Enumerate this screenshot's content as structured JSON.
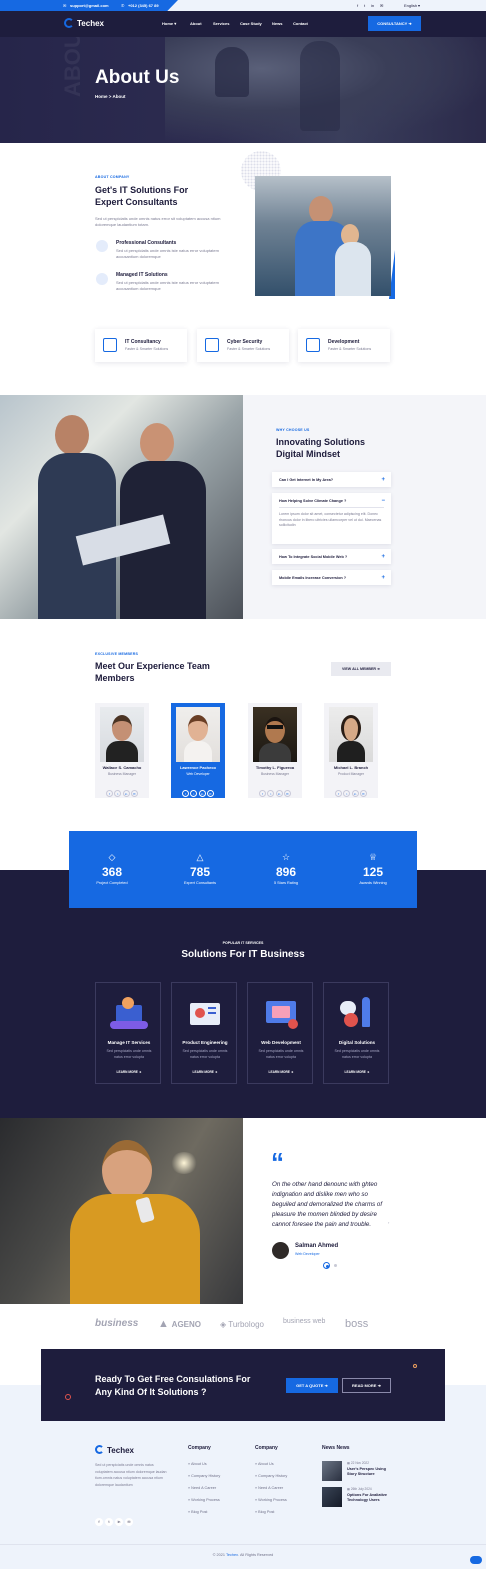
{
  "topbar": {
    "email": "support@gmail.com",
    "phone": "+012 (345) 67 89",
    "language": "English"
  },
  "nav": {
    "brand": "Techex",
    "items": [
      "Home",
      "About",
      "Services",
      "Case Study",
      "News",
      "Contact"
    ],
    "cta": "CONSULTANCY"
  },
  "hero": {
    "title": "About Us",
    "breadcrumb_home": "Home",
    "breadcrumb_sep": ">",
    "breadcrumb_current": "About",
    "watermark": "ABOUT"
  },
  "about": {
    "tag": "ABOUT COMPANY",
    "title_line1": "Get's IT Solutions For",
    "title_line2": "Expert Consultants",
    "text": "Sed ut perspiciatis unde omnis natus error sit voluptatem accusa ntium doloremque laudantium totam.",
    "features": [
      {
        "title": "Professional Consultants",
        "text": "Sed ut perspiciatis unde omnis iste natus error voluptatem accusantium doloremque"
      },
      {
        "title": "Managed IT Solutions",
        "text": "Sed ut perspiciatis unde omnis iste natus error voluptatem accusantium doloremque"
      }
    ]
  },
  "mini_services": [
    {
      "title": "IT Consultancy",
      "sub": "Faster & Smarter Solutions"
    },
    {
      "title": "Cyber Security",
      "sub": "Faster & Smarter Solutions"
    },
    {
      "title": "Development",
      "sub": "Faster & Smarter Solutions"
    }
  ],
  "why": {
    "tag": "WHY CHOOSE US",
    "title_line1": "Innovating Solutions",
    "title_line2": "Digital Mindset",
    "faqs": [
      {
        "q": "Can I Get Internet In My Area?",
        "icon": "+"
      },
      {
        "q": "How Helping Solve Climate Change ?",
        "icon": "−",
        "a": "Lorem ipsum dolor sit amet, consectetur adipiscing elit. Donec rhoncus dolor in libero ultricies ullamcorper vel ut dui. Maecenas sollicitudin"
      },
      {
        "q": "How To Integrate Social Mobile Web ?",
        "icon": "+"
      },
      {
        "q": "Mobile Emails Increase Conversion ?",
        "icon": "+"
      }
    ]
  },
  "team": {
    "tag": "EXCLUSIVE MEMBERS",
    "title_line1": "Meet Our Experience Team",
    "title_line2": "Members",
    "view_all": "VIEW ALL MEMBER",
    "members": [
      {
        "name": "Wallace S. Camacho",
        "role": "Business Manager"
      },
      {
        "name": "Lawrence Pacheco",
        "role": "Web Developer"
      },
      {
        "name": "Timothy L. Figueroa",
        "role": "Business Manager"
      },
      {
        "name": "Michael L. Branch",
        "role": "Product Manager"
      }
    ]
  },
  "stats": [
    {
      "num": "368",
      "label": "Project Completed"
    },
    {
      "num": "785",
      "label": "Expert Consultants"
    },
    {
      "num": "896",
      "label": "5 Stars Rating"
    },
    {
      "num": "125",
      "label": "Awards Winning"
    }
  ],
  "services": {
    "tag": "POPULAR IT SERVICES",
    "title": "Solutions For IT Business",
    "items": [
      {
        "title": "Manage IT Services",
        "desc": "Sed perspiciatis unde omnis natus error volupta",
        "more": "LEARN MORE"
      },
      {
        "title": "Product Engineering",
        "desc": "Sed perspiciatis unde omnis natus error volupta",
        "more": "LEARN MORE"
      },
      {
        "title": "Web Development",
        "desc": "Sed perspiciatis unde omnis natus error volupta",
        "more": "LEARN MORE"
      },
      {
        "title": "Digital Solutions",
        "desc": "Sed perspiciatis unde omnis natus error volupta",
        "more": "LEARN MORE"
      }
    ]
  },
  "testimonial": {
    "quote": "On the other hand denounc with ghteo indignation and dislike men who so beguiled and demoralized the charms of pleasure the momen blinded by desire cannot foresee the pain and trouble.",
    "name": "Salman Ahmed",
    "role": "Web Developer"
  },
  "brands": [
    "business",
    "AGENO",
    "Turbologo",
    "business web",
    "boss"
  ],
  "cta": {
    "title_line1": "Ready To Get Free Consulations For",
    "title_line2": "Any Kind Of It Solutions ?",
    "btn1": "GET A QUOTE",
    "btn2": "READ MORE"
  },
  "footer": {
    "brand": "Techex",
    "about": "Sed ut perspiciatis unde omnis natus voluptatem accusa ntium doloremque laudan tium.omnis natus voluptatem accusa ntium doloremque laudantium",
    "col1_title": "Company",
    "col1_links": [
      "About Us",
      "Company History",
      "Need A Career",
      "Working Process",
      "Blog Post"
    ],
    "col2_title": "Company",
    "col2_links": [
      "About Us",
      "Company History",
      "Need A Career",
      "Working Process",
      "Blog Post"
    ],
    "news_title": "News News",
    "news": [
      {
        "date": "22 Nov 2022",
        "title": "User's Perspec Using Story Structure"
      },
      {
        "date": "26th July 2024",
        "title": "Options For Avaliative Technology Users"
      }
    ],
    "copyright_pre": "© 2021",
    "copyright_brand": "Techex",
    "copyright_post": ". All Rights Reserved"
  }
}
